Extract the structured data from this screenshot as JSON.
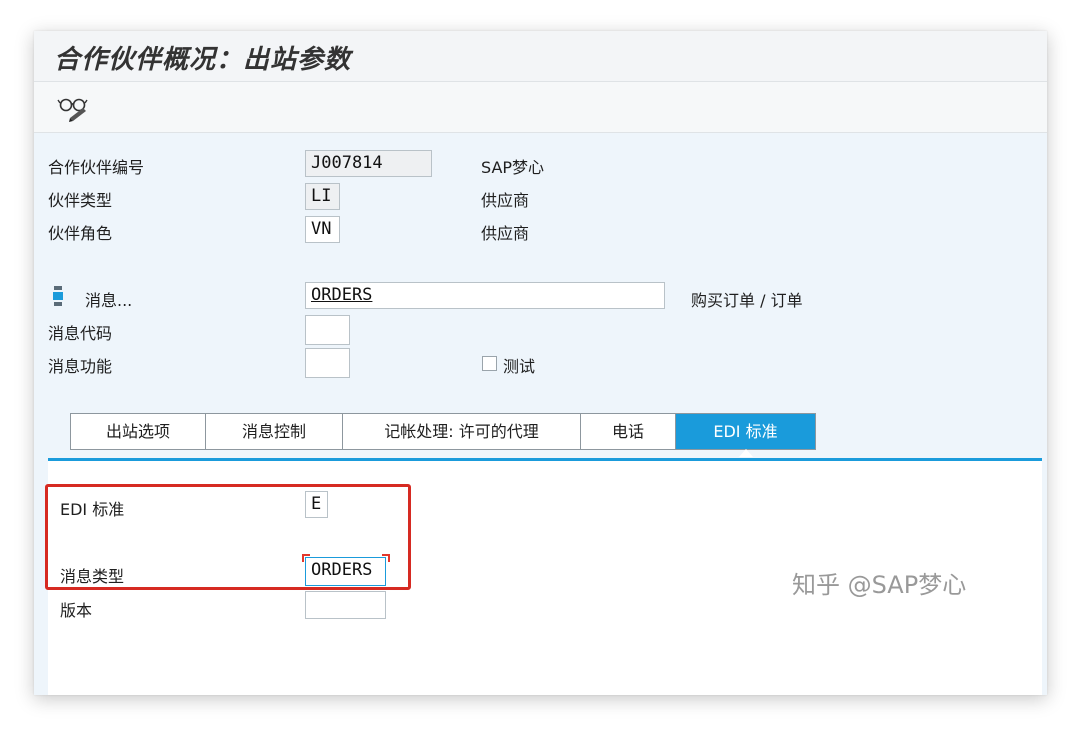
{
  "window": {
    "title": "合作伙伴概况：出站参数"
  },
  "toolbar": {
    "display_change_icon": "glasses-pencil-icon"
  },
  "header_fields": {
    "partner_number": {
      "label": "合作伙伴编号",
      "value": "J007814",
      "description": "SAP梦心"
    },
    "partner_type": {
      "label": "伙伴类型",
      "value": "LI",
      "description": "供应商"
    },
    "partner_role": {
      "label": "伙伴角色",
      "value": "VN",
      "description": "供应商"
    }
  },
  "message": {
    "icon": "message-type-icon",
    "label": "消息...",
    "value": "ORDERS",
    "description": "购买订单 / 订单",
    "code_label": "消息代码",
    "code_value": "",
    "function_label": "消息功能",
    "function_value": "",
    "test_label": "测试",
    "test_checked": false
  },
  "tabs": [
    {
      "label": "出站选项",
      "active": false
    },
    {
      "label": "消息控制",
      "active": false
    },
    {
      "label": "记帐处理: 许可的代理",
      "active": false
    },
    {
      "label": "电话",
      "active": false
    },
    {
      "label": "EDI 标准",
      "active": true
    }
  ],
  "edi_panel": {
    "standard_label": "EDI 标准",
    "standard_value": "E",
    "message_type_label": "消息类型",
    "message_type_value": "ORDERS",
    "version_label": "版本",
    "version_value": ""
  },
  "watermark": "知乎 @SAP梦心",
  "colors": {
    "accent": "#1a9bdb",
    "highlight_box": "#d62a22",
    "content_bg": "#eef5fb"
  }
}
